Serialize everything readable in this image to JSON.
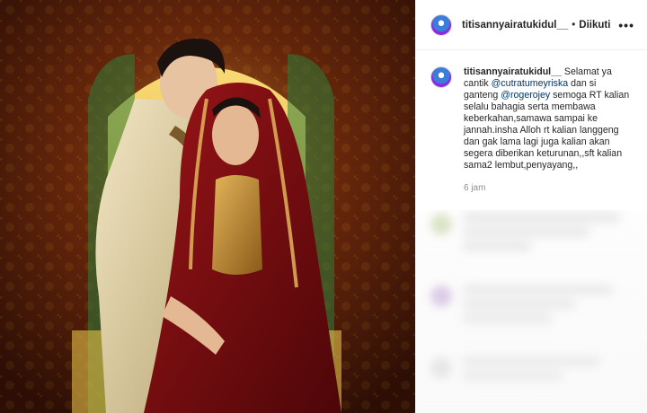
{
  "post": {
    "image_alt": "Wedding photo"
  },
  "header": {
    "username": "titisannyairatukidul__",
    "separator": "•",
    "follow_status": "Diikuti",
    "more_icon": "more-horizontal-icon"
  },
  "caption": {
    "username": "titisannyairatukidul__",
    "text_1": "Selamat ya cantik ",
    "mention_1": "@cutratumeyriska",
    "text_2": " dan si ganteng ",
    "mention_2": "@rogerojey",
    "text_3": " semoga RT kalian selalu bahagia serta membawa keberkahan,samawa sampai ke jannah.insha Alloh rt kalian langgeng dan gak lama lagi juga kalian akan segera diberikan keturunan,,sft kalian sama2 lembut,penyayang,,",
    "timestamp": "6 jam"
  },
  "colors": {
    "mention": "#00376b",
    "muted": "#8e8e8e",
    "text": "#262626"
  }
}
